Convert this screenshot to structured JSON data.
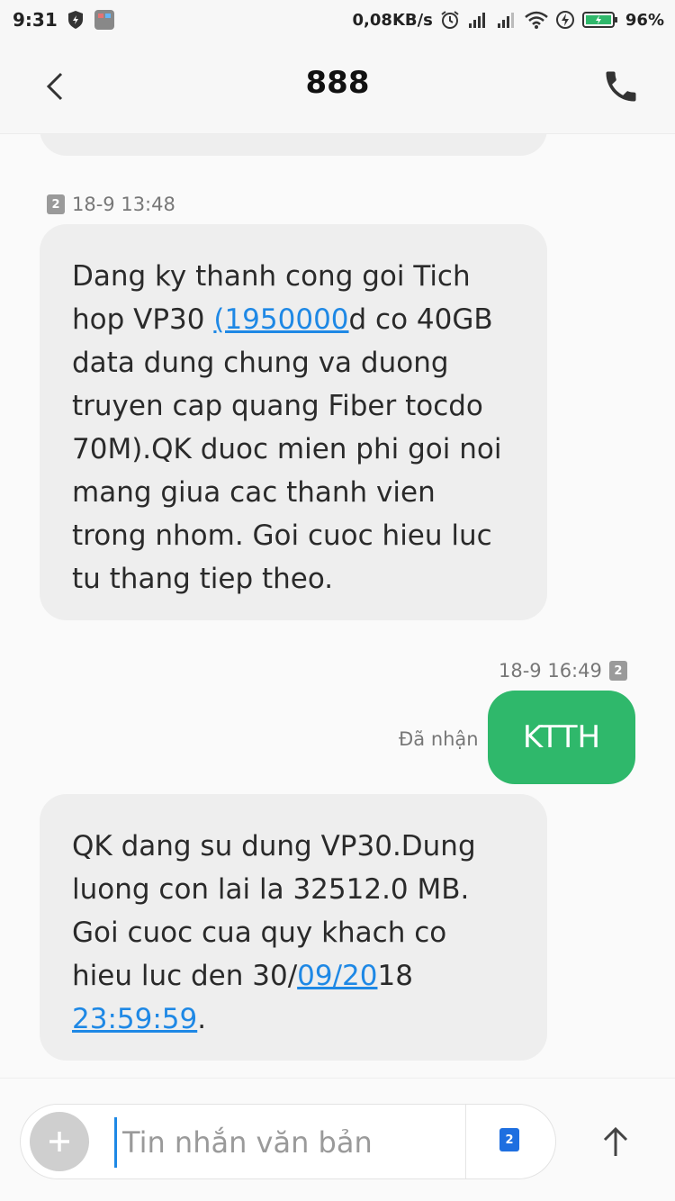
{
  "status_bar": {
    "time": "9:31",
    "net_speed": "0,08KB/s",
    "battery": "96%"
  },
  "header": {
    "title": "888"
  },
  "messages": [
    {
      "direction": "incoming",
      "timestamp": "18-9 13:48",
      "sim": "2",
      "text": {
        "p1": "Dang ky thanh cong goi Tich hop VP30 ",
        "link": "(1950000",
        "p2": "d co 40GB data dung chung va duong truyen cap quang Fiber tocdo 70M).QK duoc mien phi goi noi mang giua cac thanh vien trong nhom. Goi cuoc hieu luc tu thang tiep theo."
      }
    },
    {
      "direction": "outgoing",
      "timestamp": "18-9 16:49",
      "sim": "2",
      "status": "Đã nhận",
      "text": "KTTH"
    },
    {
      "direction": "incoming",
      "text": {
        "p1": "QK dang su dung VP30.Dung luong con lai la 32512.0 MB. Goi cuoc cua quy khach co hieu luc den 30/",
        "link1": "09/20",
        "p2": "18 ",
        "link2": "23:59:59",
        "p3": "."
      }
    }
  ],
  "composer": {
    "placeholder": "Tin nhắn văn bản",
    "sim": "2"
  },
  "colors": {
    "outgoing_bubble": "#2fb86b",
    "incoming_bubble": "#eeeeee",
    "link": "#1e88e5"
  }
}
